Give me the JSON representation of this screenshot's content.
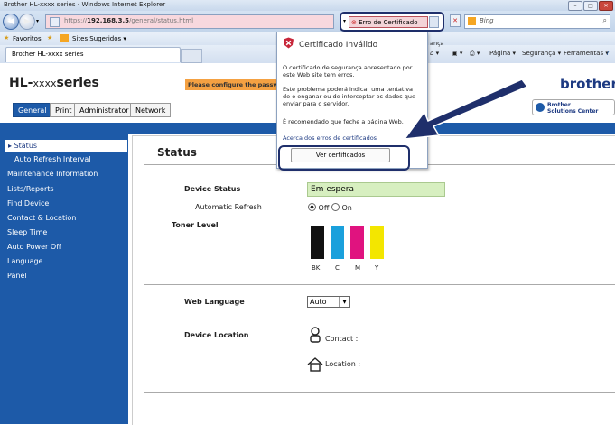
{
  "browser": {
    "window_title": "Brother HL-xxxx series - Windows Internet Explorer",
    "url_prefix": "https://",
    "url_host": "192.168.3.5",
    "url_path": "/general/status.html",
    "cert_error_label": "Erro de Certificado",
    "search_placeholder": "Bing",
    "favorites_label": "Favoritos",
    "suggested_sites_label": "Sites Sugeridos ▾",
    "tab_title": "Brother HL-xxxx series",
    "cmd_page": "Página ▾",
    "cmd_security": "Segurança ▾",
    "cmd_tools": "Ferramentas ▾",
    "hidden_tooltip_fragment": "ança"
  },
  "cert_popup": {
    "title": "Certificado Inválido",
    "para1": "O certificado de segurança apresentado por este Web site tem erros.",
    "para2": "Este problema poderá indicar uma tentativa de o enganar ou de interceptar os dados que enviar para o servidor.",
    "para3": "É recomendado que feche a página Web.",
    "link": "Acerca dos erros de certificados",
    "button": "Ver certificados"
  },
  "page": {
    "logo_main": "HL-",
    "logo_sub": "xxxx",
    "logo_series": "series",
    "config_banner": "Please configure the password",
    "brand": "brother",
    "solutions_line1": "Brother",
    "solutions_line2": "Solutions Center",
    "tabs": [
      "General",
      "Print",
      "Administrator",
      "Network"
    ],
    "sidebar": [
      "Status",
      "Auto Refresh Interval",
      "Maintenance Information",
      "Lists/Reports",
      "Find Device",
      "Contact & Location",
      "Sleep Time",
      "Auto Power Off",
      "Language",
      "Panel"
    ],
    "heading": "Status",
    "device_status_label": "Device Status",
    "device_status_value": "Em espera",
    "auto_refresh_label": "Automatic Refresh",
    "radio_off": "Off",
    "radio_on": "On",
    "toner_label": "Toner Level",
    "toner_names": [
      "BK",
      "C",
      "M",
      "Y"
    ],
    "toner_colors": [
      "#111111",
      "#1aa0dc",
      "#e0137f",
      "#f3e600"
    ],
    "toner_levels": [
      1,
      1,
      1,
      1
    ],
    "web_language_label": "Web Language",
    "web_language_value": "Auto",
    "device_location_label": "Device Location",
    "contact_label": "Contact :",
    "location_label": "Location :"
  }
}
